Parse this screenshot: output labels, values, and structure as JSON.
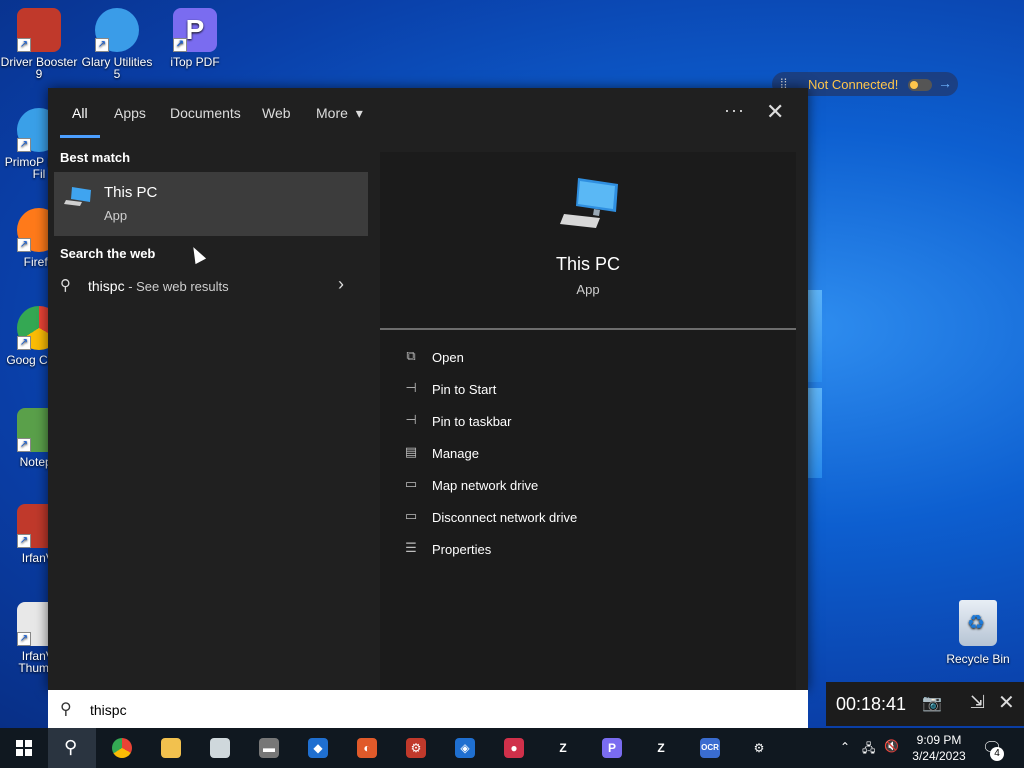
{
  "desktop": {
    "icons": [
      {
        "label": "Driver Booster 9",
        "color": "#c0392b"
      },
      {
        "label": "Glary Utilities 5",
        "color": "#3a9ce8"
      },
      {
        "label": "iTop PDF",
        "color": "#7a6cf0"
      },
      {
        "label": "PrimoP Drop Fil",
        "color": "#3aa0e8"
      },
      {
        "label": "Firefo",
        "color": "#ff7a1a"
      },
      {
        "label": "Goog Chron",
        "color": "#e8e8e8"
      },
      {
        "label": "Notepa",
        "color": "#5aa04a"
      },
      {
        "label": "IrfanVi",
        "color": "#c0392b"
      },
      {
        "label": "IrfanVi Thumbr",
        "color": "#333333"
      }
    ],
    "recycle_bin": "Recycle Bin"
  },
  "vpn_widget": {
    "status": "Not Connected!"
  },
  "search_panel": {
    "tabs": [
      "All",
      "Apps",
      "Documents",
      "Web",
      "More"
    ],
    "more_arrow": "▾",
    "more_options": "···",
    "close": "✕",
    "best_match_heading": "Best match",
    "best_match": {
      "title": "This PC",
      "subtitle": "App"
    },
    "search_web_heading": "Search the web",
    "web_result": {
      "query": "thispc",
      "suffix": " - See web results"
    },
    "preview": {
      "title": "This PC",
      "subtitle": "App"
    },
    "actions": [
      {
        "label": "Open",
        "icon": "open-icon"
      },
      {
        "label": "Pin to Start",
        "icon": "pin-icon"
      },
      {
        "label": "Pin to taskbar",
        "icon": "pin-icon"
      },
      {
        "label": "Manage",
        "icon": "manage-icon"
      },
      {
        "label": "Map network drive",
        "icon": "network-drive-icon"
      },
      {
        "label": "Disconnect network drive",
        "icon": "network-drive-icon"
      },
      {
        "label": "Properties",
        "icon": "properties-icon"
      }
    ]
  },
  "search_box": {
    "value": "thispc"
  },
  "timer_widget": {
    "time": "00:18:41"
  },
  "taskbar": {
    "apps": [
      {
        "name": "chrome",
        "color": "#e8e8e8",
        "glyph": ""
      },
      {
        "name": "file-explorer",
        "color": "#f2c14e",
        "glyph": ""
      },
      {
        "name": "notepad-app",
        "color": "#cfd8dc",
        "glyph": ""
      },
      {
        "name": "app-4",
        "color": "#777777",
        "glyph": "▬"
      },
      {
        "name": "app-5",
        "color": "#1f6fd0",
        "glyph": "◆"
      },
      {
        "name": "app-6",
        "color": "#e05a2a",
        "glyph": "◐"
      },
      {
        "name": "driver-booster",
        "color": "#c0392b",
        "glyph": "⚙"
      },
      {
        "name": "shield-app",
        "color": "#1f6fd0",
        "glyph": "◈"
      },
      {
        "name": "recorder-app",
        "color": "#d0304a",
        "glyph": "●"
      },
      {
        "name": "z-app",
        "color": "#ffffff",
        "glyph": "Z"
      },
      {
        "name": "itop-pdf",
        "color": "#7a6cf0",
        "glyph": "P"
      },
      {
        "name": "z-app-2",
        "color": "#ffffff",
        "glyph": "Z"
      },
      {
        "name": "ocr-app",
        "color": "#3a6cd0",
        "glyph": "OCR"
      },
      {
        "name": "settings",
        "color": "#ffffff",
        "glyph": "⚙"
      }
    ],
    "clock": {
      "time": "9:09 PM",
      "date": "3/24/2023"
    },
    "notification_count": "4"
  }
}
